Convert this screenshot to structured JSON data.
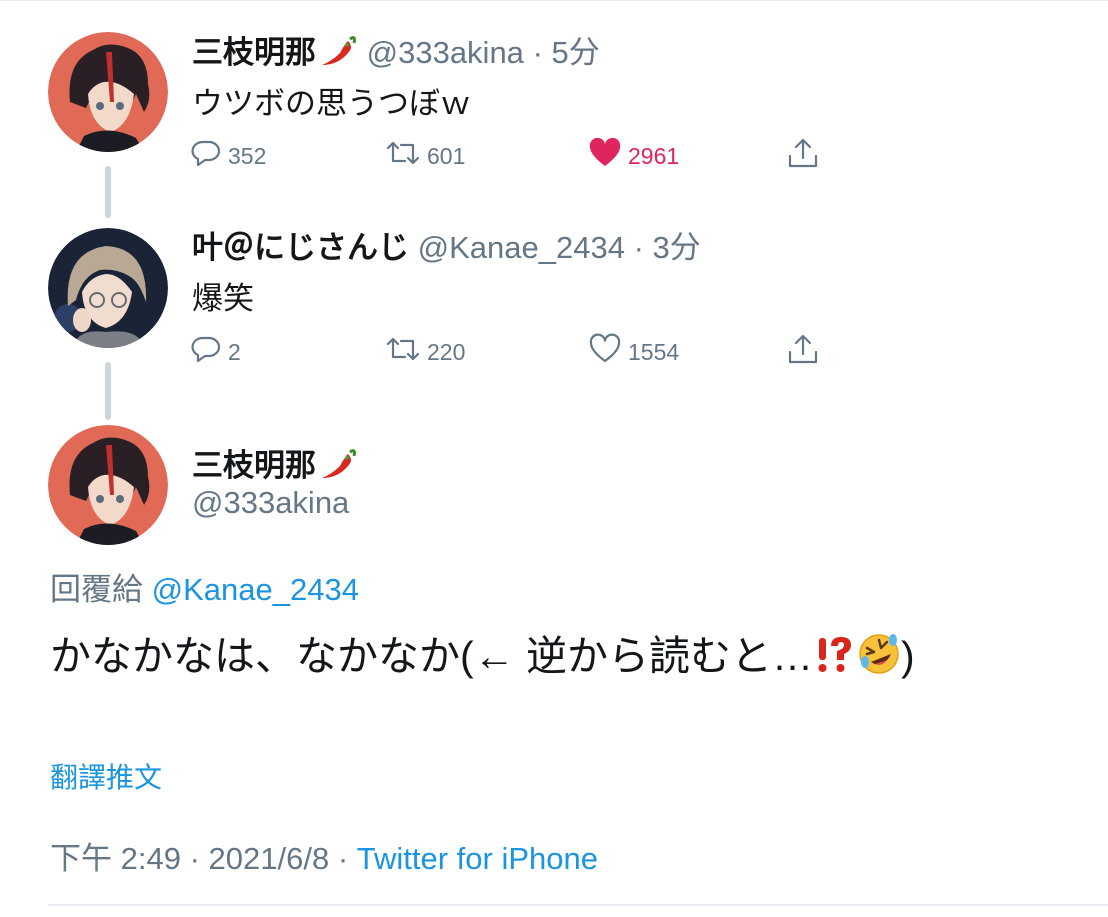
{
  "tweets": [
    {
      "name": "三枝明那",
      "name_emoji": "hot-pepper",
      "handle": "@333akina",
      "separator": "·",
      "time": "5分",
      "text": "ウツボの思うつぼｗ",
      "replies": "352",
      "retweets": "601",
      "likes": "2961",
      "liked": true
    },
    {
      "name": "叶＠にじさんじ",
      "handle": "@Kanae_2434",
      "separator": "·",
      "time": "3分",
      "text": "爆笑",
      "replies": "2",
      "retweets": "220",
      "likes": "1554",
      "liked": false
    }
  ],
  "main_tweet": {
    "name": "三枝明那",
    "name_emoji": "hot-pepper",
    "handle": "@333akina",
    "reply_label": "回覆給",
    "reply_to": "@Kanae_2434",
    "text": "かなかなは、なかなか(← 逆から読むと…",
    "text_emojis": [
      "exclamation-question-mark",
      "rolling-on-floor-laughing"
    ],
    "text_end": ")",
    "translate_label": "翻譯推文",
    "time": "下午 2:49",
    "date": "2021/6/8",
    "separator": "·",
    "source": "Twitter for iPhone"
  },
  "colors": {
    "text": "#14171a",
    "secondary": "#657786",
    "link": "#1b95e0",
    "like": "#e0245e",
    "thread_line": "#ccd6dd"
  }
}
